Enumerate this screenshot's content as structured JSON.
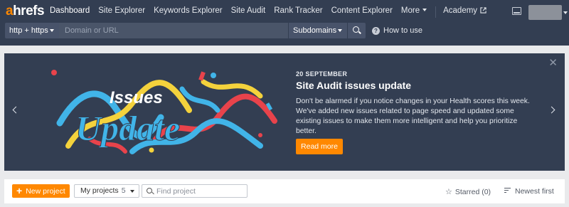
{
  "brand": {
    "logo_a": "a",
    "logo_rest": "hrefs",
    "accent": "#ff8800"
  },
  "nav": {
    "items": [
      {
        "label": "Dashboard",
        "active": true
      },
      {
        "label": "Site Explorer"
      },
      {
        "label": "Keywords Explorer"
      },
      {
        "label": "Site Audit"
      },
      {
        "label": "Rank Tracker"
      },
      {
        "label": "Content Explorer"
      },
      {
        "label": "More"
      }
    ],
    "academy": "Academy"
  },
  "search": {
    "protocol": "http + https",
    "placeholder": "Domain or URL",
    "mode": "Subdomains",
    "how_to": "How to use"
  },
  "banner": {
    "date": "20 SEPTEMBER",
    "title": "Site Audit issues update",
    "body": "Don't be alarmed if you notice changes in your Health scores this week. We've added new issues related to page speed and updated some existing issues to make them more intelligent and help you prioritize better.",
    "button": "Read more",
    "art_word1": "Issues",
    "art_word2": "Update"
  },
  "toolbar": {
    "new_project": "New project",
    "my_projects": "My projects",
    "project_count": "5",
    "find_placeholder": "Find project",
    "starred": "Starred (0)",
    "sort": "Newest first"
  }
}
